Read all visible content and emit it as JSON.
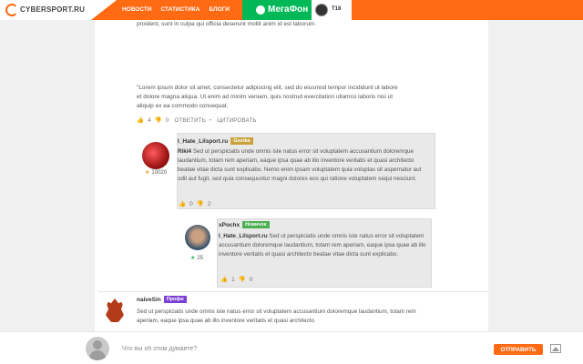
{
  "header": {
    "logo_text": "CYBERSPORT.RU",
    "nav": [
      "НОВОСТИ",
      "СТАТИСТИКА",
      "БЛОГИ"
    ],
    "sponsor": "МегаФон",
    "user_level": "T18",
    "colors": {
      "accent": "#ff6a13",
      "sponsor": "#00b956"
    }
  },
  "post": {
    "text_top": "proident, sunt in culpa qui officia deserunt mollit anim id est laborum.",
    "text_main": "\"Lorem ipsum dolor sit amet, consectetur adipiscing elit, sed do eiusmod tempor incididunt ut labore et dolore magna aliqua. Ut enim ad minim veniam, quis nostrud exercitation ullamco laboris nisi ut aliquip ex ea commodo consequat.",
    "likes": "4",
    "dislikes": "0",
    "reply_label": "ОТВЕТИТЬ",
    "quote_label": "ЦИТИРОВАТЬ"
  },
  "comments": [
    {
      "username": "I_Hate_Lilsport.ru",
      "badge": "Gosika",
      "rating": "10020",
      "addressee": "Riki4",
      "text": "Sed ut perspiciatis unde omnis iste natus error sit voluptatem accusantium doloremque laudantium, totam rem aperiam, eaque ipsa quae ab illo inventore veritatis et quasi architecto beatae vitae dicta sunt explicabo. Nemo enim ipsam voluptatem quia voluptas sit aspernatur aut odit aut fugit, sed quia consequuntur magni dolores eos qui ratione voluptatem sequi nesciunt.",
      "likes": "0",
      "dislikes": "2"
    },
    {
      "username": "xPochx",
      "badge": "Новичок",
      "rating": "25",
      "addressee": "I_Hate_Lilsport.ru",
      "text": "Sed ut perspiciatis unde omnis iste natus error sit voluptatem accusantium doloremque laudantium, totam rem aperiam, eaque ipsa quae ab illo inventore veritatis et quasi architecto beatae vitae dicta sunt explicabo.",
      "likes": "1",
      "dislikes": "0"
    },
    {
      "username": "naiveSin",
      "badge": "Профи",
      "text": "Sed ut perspiciatis unde omnis iste natus error sit voluptatem accusantium doloremque laudantium, totam rem aperiam, eaque ipsa quae ab illo inventore veritatis et quasi architecto"
    }
  ],
  "compose": {
    "placeholder": "Что вы об этом думаете?",
    "send_label": "ОТПРАВИТЬ"
  }
}
